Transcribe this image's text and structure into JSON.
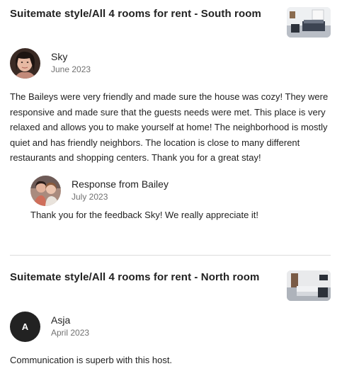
{
  "reviews": [
    {
      "listing_title": "Suitemate style/All 4 rooms for rent - South room",
      "author": "Sky",
      "date": "June 2023",
      "text": "The Baileys were very friendly and made sure the house was cozy! They were responsive and made sure that the guests needs were met. This place is very relaxed and allows you to make yourself at home! The neighborhood is mostly quiet and has friendly neighbors. The location is close to many different restaurants and shopping centers. Thank you for a great stay!",
      "response": {
        "label": "Response from Bailey",
        "date": "July 2023",
        "text": "Thank you for the feedback Sky! We really appreciate it!"
      }
    },
    {
      "listing_title": "Suitemate style/All 4 rooms for rent - North room",
      "author": "Asja",
      "avatar_initial": "A",
      "date": "April 2023",
      "text": "Communication is superb with this host."
    }
  ]
}
